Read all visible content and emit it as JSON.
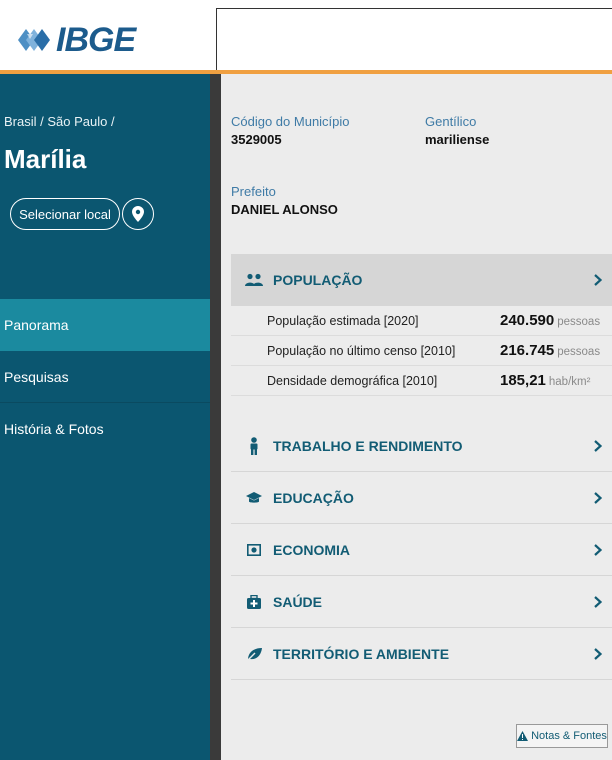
{
  "header": {
    "logo_text": "IBGE",
    "brand_color": "#1c5b8c",
    "accent_color": "#f0a041"
  },
  "sidebar": {
    "breadcrumb": "Brasil / São Paulo /",
    "city": "Marília",
    "select_button": "Selecionar local",
    "pin_icon": "map-pin-icon",
    "background": "#0b5670",
    "active_color": "#1b8a9f",
    "nav": [
      {
        "label": "Panorama",
        "active": true
      },
      {
        "label": "Pesquisas",
        "active": false
      },
      {
        "label": "História & Fotos",
        "active": false
      }
    ]
  },
  "info": {
    "codigo_label": "Código do Município",
    "codigo_value": "3529005",
    "gentilico_label": "Gentílico",
    "gentilico_value": "mariliense",
    "prefeito_label": "Prefeito",
    "prefeito_value": "DANIEL ALONSO"
  },
  "sections": [
    {
      "title": "POPULAÇÃO",
      "icon": "people-icon",
      "open": true,
      "rows": [
        {
          "label": "População estimada [2020]",
          "value": "240.590",
          "unit": "pessoas"
        },
        {
          "label": "População no último censo [2010]",
          "value": "216.745",
          "unit": "pessoas"
        },
        {
          "label": "Densidade demográfica [2010]",
          "value": "185,21",
          "unit": "hab/km²"
        }
      ]
    },
    {
      "title": "TRABALHO E RENDIMENTO",
      "icon": "worker-icon",
      "open": false
    },
    {
      "title": "EDUCAÇÃO",
      "icon": "graduation-cap-icon",
      "open": false
    },
    {
      "title": "ECONOMIA",
      "icon": "money-icon",
      "open": false
    },
    {
      "title": "SAÚDE",
      "icon": "medical-kit-icon",
      "open": false
    },
    {
      "title": "TERRITÓRIO E AMBIENTE",
      "icon": "leaf-icon",
      "open": false
    }
  ],
  "footer": {
    "notes_button": "Notas & Fontes",
    "notes_icon": "warning-icon"
  }
}
